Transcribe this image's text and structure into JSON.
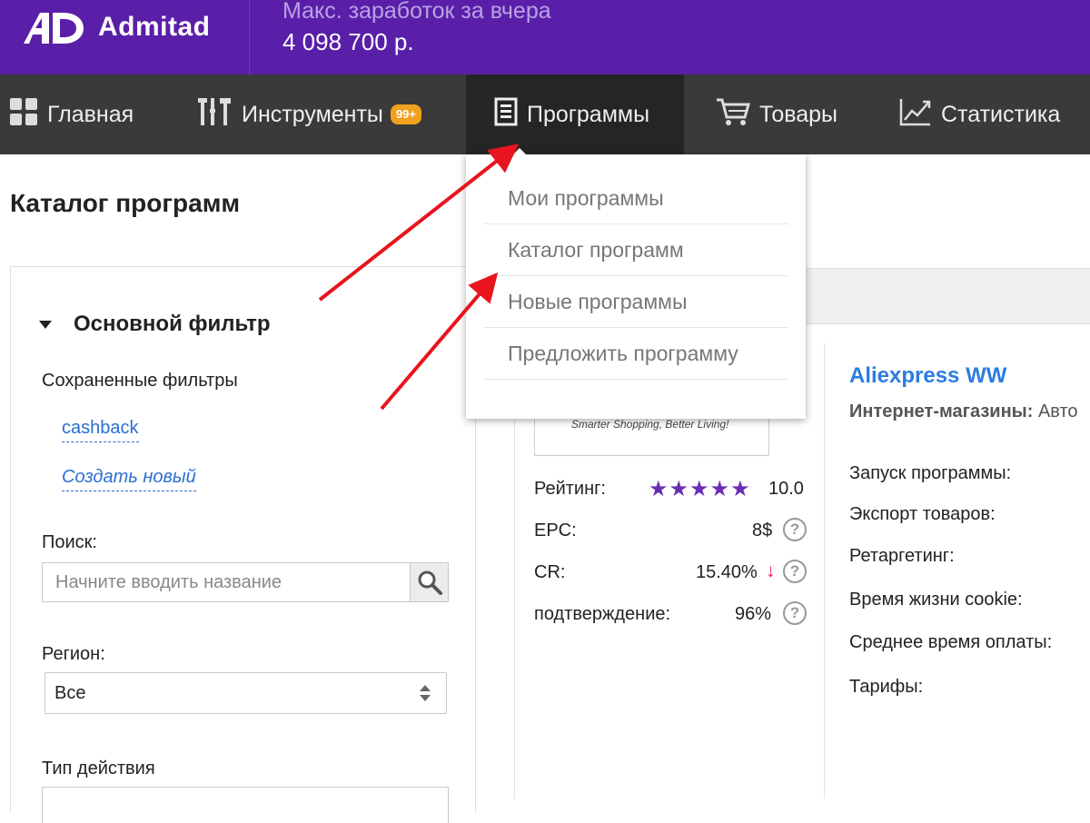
{
  "brand": {
    "name": "Admitad"
  },
  "earnings": {
    "label": "Макс. заработок за вчера",
    "value": "4 098 700 р."
  },
  "nav": {
    "items": [
      {
        "label": "Главная",
        "icon": "grid-icon"
      },
      {
        "label": "Инструменты",
        "icon": "tools-icon",
        "badge": "99+"
      },
      {
        "label": "Программы",
        "icon": "document-icon",
        "active": true
      },
      {
        "label": "Товары",
        "icon": "cart-icon"
      },
      {
        "label": "Статистика",
        "icon": "chart-icon"
      }
    ]
  },
  "dropdown": {
    "items": [
      "Мои программы",
      "Каталог программ",
      "Новые программы",
      "Предложить программу"
    ]
  },
  "page": {
    "title": "Каталог программ"
  },
  "filter": {
    "title": "Основной фильтр",
    "saved_label": "Сохраненные фильтры",
    "saved_link": "cashback",
    "create_link": "Создать новый",
    "search_label": "Поиск:",
    "search_placeholder": "Начните вводить название",
    "region_label": "Регион:",
    "region_value": "Все",
    "action_label": "Тип действия"
  },
  "program": {
    "logo_tagline": "Smarter Shopping, Better Living!",
    "name": "Aliexpress WW",
    "category_label": "Интернет-магазины:",
    "category_value": "Авто",
    "metrics": [
      {
        "label": "Рейтинг:",
        "value": "10.0",
        "stars": 5
      },
      {
        "label": "EPC:",
        "value": "8$"
      },
      {
        "label": "CR:",
        "value": "15.40%",
        "trend": "down"
      },
      {
        "label": "подтверждение:",
        "value": "96%"
      }
    ],
    "details": [
      "Запуск программы:",
      "Экспорт товаров:",
      "Ретаргетинг:",
      "Время жизни cookie:",
      "Среднее время оплаты:",
      "Тарифы:"
    ]
  },
  "colors": {
    "topbar": "#5a1fa8",
    "navbar": "#3a3a3a",
    "accent_link": "#2b6fcf",
    "badge": "#f1a11e",
    "annotation_arrow": "#e8141e"
  }
}
